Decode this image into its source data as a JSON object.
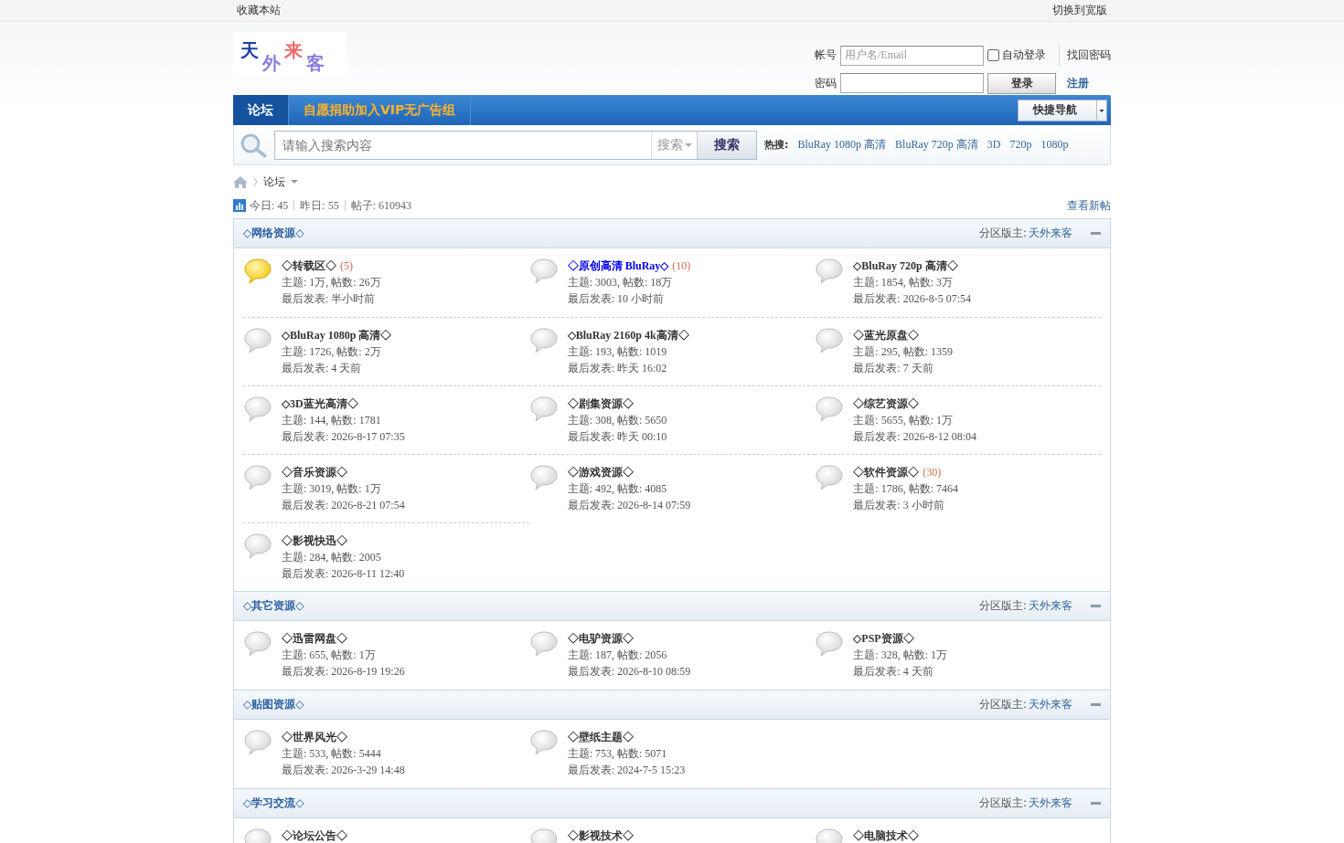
{
  "topbar": {
    "left": "收藏本站",
    "right": "切换到宽版"
  },
  "logo": {
    "chars": [
      "天",
      "外",
      "来",
      "客"
    ]
  },
  "login": {
    "account_label": "帐号",
    "account_placeholder": "用户名/Email",
    "auto_login": {
      "label": "自动登录",
      "checked": false
    },
    "forgot": "找回密码",
    "password_label": "密码",
    "login_button": "登录",
    "register": "注册"
  },
  "nav": {
    "items": [
      {
        "label": "论坛",
        "selected": true
      },
      {
        "label": "自愿捐助加入VIP无广告组",
        "selected": false
      }
    ],
    "quick_nav": "快捷导航"
  },
  "search": {
    "placeholder": "请输入搜索内容",
    "scope": "搜索",
    "button": "搜索",
    "hot_label": "热搜:",
    "hot": [
      "BluRay 1080p 高清",
      "BluRay 720p 高清",
      "3D",
      "720p",
      "1080p"
    ]
  },
  "breadcrumb": {
    "current": "论坛"
  },
  "stats": {
    "items": [
      "今日: 45",
      "昨日: 55",
      "帖子: 610943"
    ],
    "new_posts": "查看新帖"
  },
  "sections": [
    {
      "title": "◇网络资源◇",
      "moderator_label": "分区版主:",
      "moderator": "天外来客",
      "forums": [
        {
          "name": "◇转载区◇",
          "count": "(5)",
          "topics": "主题: 1万, 帖数: 26万",
          "last": "最后发表: 半小时前",
          "new": true,
          "color": "#333333"
        },
        {
          "name": "◇原创高清 BluRay◇",
          "count": "(10)",
          "topics": "主题: 3003, 帖数: 18万",
          "last": "最后发表: 10 小时前",
          "new": false,
          "color": "#0000ee"
        },
        {
          "name": "◇BluRay 720p 高清◇",
          "topics": "主题: 1854, 帖数: 3万",
          "last": "最后发表: 2026-8-5 07:54",
          "new": false,
          "color": "#333333"
        },
        {
          "name": "◇BluRay 1080p 高清◇",
          "topics": "主题: 1726, 帖数: 2万",
          "last": "最后发表: 4 天前",
          "new": false,
          "color": "#333333"
        },
        {
          "name": "◇BluRay 2160p 4k高清◇",
          "topics": "主题: 193, 帖数: 1019",
          "last": "最后发表: 昨天 16:02",
          "new": false,
          "color": "#333333"
        },
        {
          "name": "◇蓝光原盘◇",
          "topics": "主题: 295, 帖数: 1359",
          "last": "最后发表: 7 天前",
          "new": false,
          "color": "#333333"
        },
        {
          "name": "◇3D蓝光高清◇",
          "topics": "主题: 144, 帖数: 1781",
          "last": "最后发表: 2026-8-17 07:35",
          "new": false,
          "color": "#333333"
        },
        {
          "name": "◇剧集资源◇",
          "topics": "主题: 308, 帖数: 5650",
          "last": "最后发表: 昨天 00:10",
          "new": false,
          "color": "#333333"
        },
        {
          "name": "◇综艺资源◇",
          "topics": "主题: 5655, 帖数: 1万",
          "last": "最后发表: 2026-8-12 08:04",
          "new": false,
          "color": "#333333"
        },
        {
          "name": "◇音乐资源◇",
          "topics": "主题: 3019, 帖数: 1万",
          "last": "最后发表: 2026-8-21 07:54",
          "new": false,
          "color": "#333333"
        },
        {
          "name": "◇游戏资源◇",
          "topics": "主题: 492, 帖数: 4085",
          "last": "最后发表: 2026-8-14 07:59",
          "new": false,
          "color": "#333333"
        },
        {
          "name": "◇软件资源◇",
          "count": "(30)",
          "topics": "主题: 1786, 帖数: 7464",
          "last": "最后发表: 3 小时前",
          "new": false,
          "color": "#333333"
        },
        {
          "name": "◇影视快迅◇",
          "topics": "主题: 284, 帖数: 2005",
          "last": "最后发表: 2026-8-11 12:40",
          "new": false,
          "color": "#333333"
        }
      ]
    },
    {
      "title": "◇其它资源◇",
      "moderator_label": "分区版主:",
      "moderator": "天外来客",
      "forums": [
        {
          "name": "◇迅雷网盘◇",
          "topics": "主题: 655, 帖数: 1万",
          "last": "最后发表: 2026-8-19 19:26",
          "new": false,
          "color": "#333333"
        },
        {
          "name": "◇电驴资源◇",
          "topics": "主题: 187, 帖数: 2056",
          "last": "最后发表: 2026-8-10 08:59",
          "new": false,
          "color": "#333333"
        },
        {
          "name": "◇PSP资源◇",
          "topics": "主题: 328, 帖数: 1万",
          "last": "最后发表: 4 天前",
          "new": false,
          "color": "#333333"
        }
      ]
    },
    {
      "title": "◇贴图资源◇",
      "moderator_label": "分区版主:",
      "moderator": "天外来客",
      "forums": [
        {
          "name": "◇世界风光◇",
          "topics": "主题: 533, 帖数: 5444",
          "last": "最后发表: 2026-3-29 14:48",
          "new": false,
          "color": "#333333"
        },
        {
          "name": "◇壁纸主题◇",
          "topics": "主题: 753, 帖数: 5071",
          "last": "最后发表: 2024-7-5 15:23",
          "new": false,
          "color": "#333333"
        }
      ]
    },
    {
      "title": "◇学习交流◇",
      "moderator_label": "分区版主:",
      "moderator": "天外来客",
      "forums": [
        {
          "name": "◇论坛公告◇",
          "new": false,
          "color": "#333333"
        },
        {
          "name": "◇影视技术◇",
          "new": false,
          "color": "#333333"
        },
        {
          "name": "◇电脑技术◇",
          "new": false,
          "color": "#333333"
        }
      ]
    }
  ]
}
